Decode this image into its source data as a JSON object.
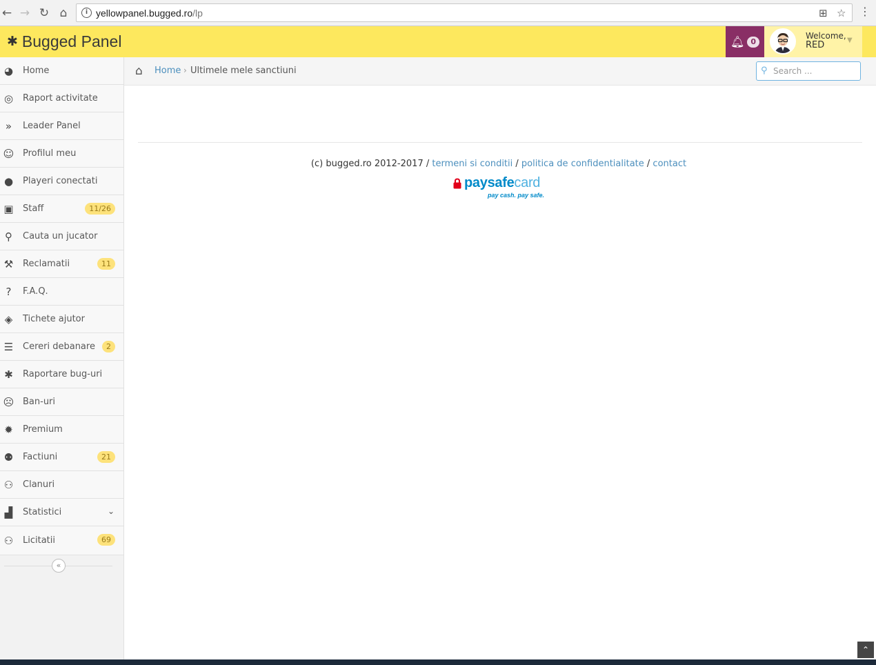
{
  "browser": {
    "url_host": "yellowpanel.bugged.ro",
    "url_path": "/lp"
  },
  "header": {
    "brand": "Bugged Panel",
    "notifications_count": "0",
    "welcome": "Welcome,",
    "username": "RED"
  },
  "sidebar": {
    "items": [
      {
        "label": "Home",
        "icon": "tachometer-icon",
        "glyph": "◕"
      },
      {
        "label": "Raport activitate",
        "icon": "target-icon",
        "glyph": "◎"
      },
      {
        "label": "Leader Panel",
        "icon": "double-chevron-right-icon",
        "glyph": "»"
      },
      {
        "label": "Profilul meu",
        "icon": "smile-icon",
        "glyph": "☺"
      },
      {
        "label": "Playeri conectati",
        "icon": "user-icon",
        "glyph": "●"
      },
      {
        "label": "Staff",
        "icon": "android-icon",
        "glyph": "▣",
        "badge": "11/26"
      },
      {
        "label": "Cauta un jucator",
        "icon": "search-icon",
        "glyph": "⚲"
      },
      {
        "label": "Reclamatii",
        "icon": "gavel-icon",
        "glyph": "⚒",
        "badge": "11"
      },
      {
        "label": "F.A.Q.",
        "icon": "question-icon",
        "glyph": "?"
      },
      {
        "label": "Tichete ajutor",
        "icon": "ticket-icon",
        "glyph": "◈"
      },
      {
        "label": "Cereri debanare",
        "icon": "tasks-icon",
        "glyph": "☰",
        "badge": "2"
      },
      {
        "label": "Raportare bug-uri",
        "icon": "bug-icon",
        "glyph": "✱"
      },
      {
        "label": "Ban-uri",
        "icon": "frown-icon",
        "glyph": "☹"
      },
      {
        "label": "Premium",
        "icon": "certificate-icon",
        "glyph": "✹"
      },
      {
        "label": "Factiuni",
        "icon": "users-icon",
        "glyph": "⚉",
        "badge": "21"
      },
      {
        "label": "Clanuri",
        "icon": "sitemap-icon",
        "glyph": "⚇"
      },
      {
        "label": "Statistici",
        "icon": "signal-icon",
        "glyph": "▟",
        "chevron": "⌄"
      },
      {
        "label": "Licitatii",
        "icon": "sitemap-icon",
        "glyph": "⚇",
        "badge": "69"
      }
    ],
    "collapse_glyph": "«"
  },
  "breadcrumb": {
    "home": "Home",
    "separator": "›",
    "current": "Ultimele mele sanctiuni"
  },
  "search": {
    "placeholder": "Search ..."
  },
  "footer": {
    "copyright": "(c) bugged.ro 2012-2017 / ",
    "link_terms": "termeni si conditii",
    "sep1": " / ",
    "link_privacy": "politica de confidentialitate",
    "sep2": " / ",
    "link_contact": "contact",
    "psc_pay": "pay",
    "psc_safe": "safe",
    "psc_card": "card",
    "psc_tagline": "pay cash. pay safe."
  },
  "colors": {
    "header_bg": "#fde85e",
    "notif_bg": "#892e65",
    "link": "#4c8fbd",
    "badge_bg": "#fde27b"
  }
}
